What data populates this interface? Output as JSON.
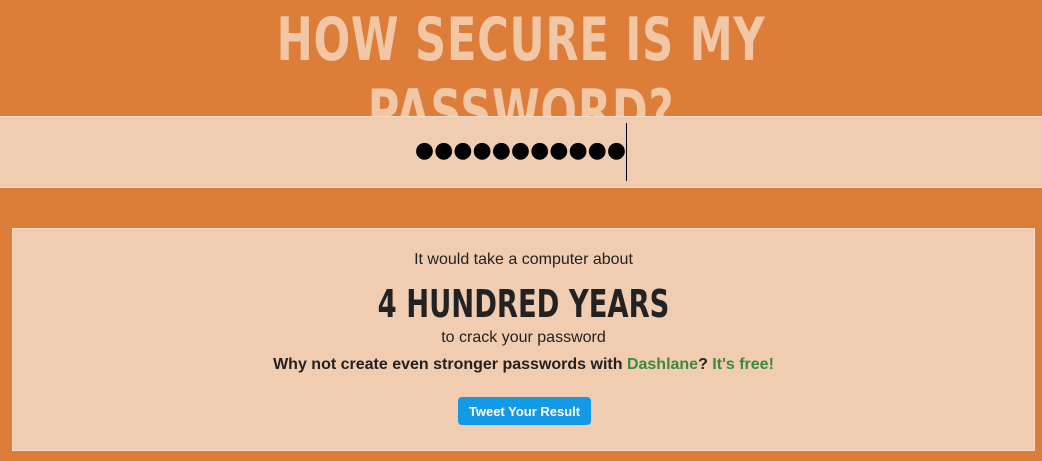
{
  "header": {
    "title": "HOW SECURE IS MY PASSWORD?"
  },
  "password_field": {
    "masked_value": "●●●●●●●●●●●"
  },
  "result": {
    "intro": "It would take a computer about",
    "time": "4 HUNDRED YEARS",
    "outro": "to crack your password",
    "promo_prefix": "Why not create even stronger passwords with ",
    "promo_link": "Dashlane",
    "promo_mid": "? ",
    "promo_free": "It's free!",
    "tweet_label": "Tweet Your Result"
  },
  "colors": {
    "background": "#dc7e3a",
    "panel": "#f0ccb1",
    "title": "#f1c7a5",
    "link": "#3d8a3d",
    "tweet_button": "#1399e6"
  }
}
